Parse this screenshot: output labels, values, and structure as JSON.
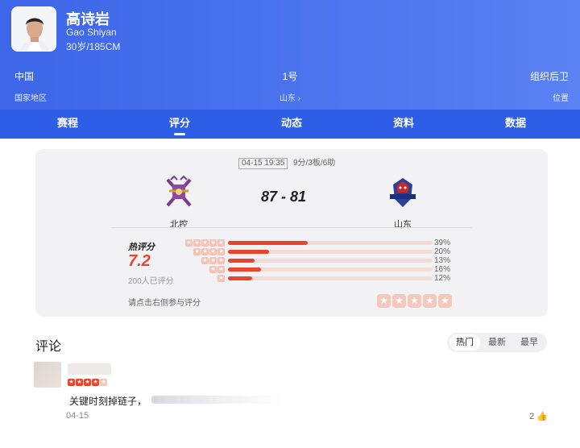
{
  "player": {
    "name": "高诗岩",
    "name_en": "Gao Shiyan",
    "meta": "30岁/185CM"
  },
  "stats": {
    "country_value": "中国",
    "country_label": "国家地区",
    "number_value": "1号",
    "team_label": "山东 ›",
    "position_value": "组织后卫",
    "position_label": "位置"
  },
  "tabs": [
    "赛程",
    "评分",
    "动态",
    "资料",
    "数据"
  ],
  "active_tab": "评分",
  "game": {
    "date": "04-15 19:35",
    "line": "9分/3板/6助",
    "home": "北控",
    "away": "山东",
    "score": "87 - 81"
  },
  "rating": {
    "label": "热评分",
    "score": "7.2",
    "count": "200人已评分",
    "hint": "请点击右侧参与评分",
    "distribution": [
      {
        "stars": 5,
        "percent": 39,
        "label": "39%"
      },
      {
        "stars": 4,
        "percent": 20,
        "label": "20%"
      },
      {
        "stars": 3,
        "percent": 13,
        "label": "13%"
      },
      {
        "stars": 2,
        "percent": 16,
        "label": "16%"
      },
      {
        "stars": 1,
        "percent": 12,
        "label": "12%"
      }
    ]
  },
  "comments": {
    "title": "评论",
    "sorts": [
      "热门",
      "最新",
      "最早"
    ],
    "active_sort": "热门",
    "items": [
      {
        "stars": 4,
        "text": "关键时刻掉链子，",
        "date": "04-15",
        "likes": "2"
      }
    ]
  },
  "colors": {
    "header": "#3d66e8",
    "tabbar": "#2f5ee6",
    "accent": "#e8452c"
  }
}
